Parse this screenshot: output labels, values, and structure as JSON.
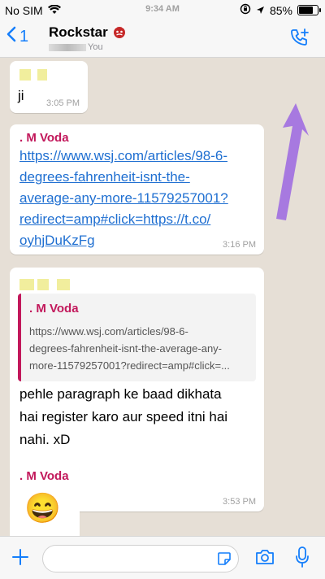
{
  "status": {
    "carrier": "No SIM",
    "time": "9:34 AM",
    "battery": "85%",
    "battery_level": 0.85
  },
  "header": {
    "back_count": "1",
    "contact_name": "Rockstar",
    "contact_sub": "You"
  },
  "messages": {
    "m1": {
      "text": "ji",
      "time": "3:05 PM"
    },
    "m2": {
      "sender": ". M Voda",
      "link_lines": [
        "https://www.wsj.com/articles/98-6-",
        "degrees-fahrenheit-isnt-the-",
        "average-any-more-11579257001?",
        "redirect=amp#click=https://t.co/",
        "oyhjDuKzFg"
      ],
      "time": "3:16 PM"
    },
    "m3": {
      "quote_sender": ". M Voda",
      "quote_lines": [
        "https://www.wsj.com/articles/98-6-",
        "degrees-fahrenheit-isnt-the-average-any-",
        "more-11579257001?redirect=amp#click=..."
      ],
      "text_lines": [
        "pehle paragraph ke baad dikhata",
        "hai register karo aur speed itni hai",
        "nahi. xD"
      ],
      "time": "3:53 PM"
    },
    "m4": {
      "sender": ". M Voda",
      "emoji": "😄"
    }
  },
  "input": {
    "placeholder": ""
  },
  "colors": {
    "accent": "#147efb",
    "sender": "#c2185b",
    "link": "#1f6fd1",
    "arrow": "#a779e0"
  },
  "icons": [
    "wifi-icon",
    "lock-rotation-icon",
    "location-icon",
    "battery-icon",
    "back-chevron-icon",
    "add-call-icon",
    "plus-icon",
    "sticker-icon",
    "camera-icon",
    "mic-icon"
  ]
}
